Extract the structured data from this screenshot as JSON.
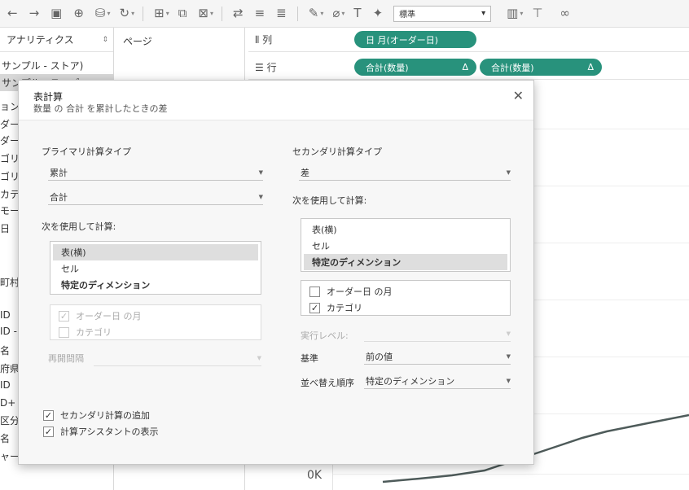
{
  "toolbar": {
    "font_select": "標準"
  },
  "left_pane": {
    "header_title": "アナリティクス",
    "sources": [
      "サンプル - ストア)",
      "サンプル - スーパー"
    ],
    "fields": [
      "ョン",
      "ダー",
      "ダー",
      "ゴリ",
      "ゴリ",
      "カテ",
      "モー",
      "日",
      "町村",
      "ID",
      "ID -",
      "名",
      "府県",
      "ID",
      "D+",
      "区分",
      "名",
      "ャー"
    ]
  },
  "pages": {
    "title": "ページ"
  },
  "shelves": {
    "columns": {
      "label": "列",
      "pills": [
        {
          "text": "日 月(オーダー日)",
          "delta": ""
        }
      ]
    },
    "rows": {
      "label": "行",
      "pills": [
        {
          "text": "合計(数量)",
          "delta": "Δ"
        },
        {
          "text": "合計(数量)",
          "delta": "Δ"
        }
      ]
    }
  },
  "view": {
    "zero_label": "0K"
  },
  "dialog": {
    "title": "表計算",
    "subtitle": "数量 の 合計 を累計したときの差",
    "primary": {
      "heading": "プライマリ計算タイプ",
      "type_value": "累計",
      "agg_value": "合計",
      "compute_using_label": "次を使用して計算:",
      "compute_using_options": [
        "表(横)",
        "セル",
        "特定のディメンション"
      ],
      "dimensions": [
        {
          "label": "オーダー日 の月",
          "checked": true
        },
        {
          "label": "カテゴリ",
          "checked": false
        }
      ],
      "restart_label": "再開間隔"
    },
    "secondary": {
      "heading": "セカンダリ計算タイプ",
      "type_value": "差",
      "compute_using_label": "次を使用して計算:",
      "compute_using_options": [
        "表(横)",
        "セル",
        "特定のディメンション"
      ],
      "dimensions": [
        {
          "label": "オーダー日 の月",
          "checked": false
        },
        {
          "label": "カテゴリ",
          "checked": true
        }
      ],
      "level_label": "実行レベル:",
      "level_value": "",
      "relative_to_label": "基準",
      "relative_to_value": "前の値",
      "sort_order_label": "並べ替え順序",
      "sort_order_value": "特定のディメンション"
    },
    "options": {
      "add_secondary": "セカンダリ計算の追加",
      "show_assistant": "計算アシスタントの表示"
    }
  },
  "colors": {
    "pill": "#28927c",
    "line": "#4e5b5a"
  }
}
